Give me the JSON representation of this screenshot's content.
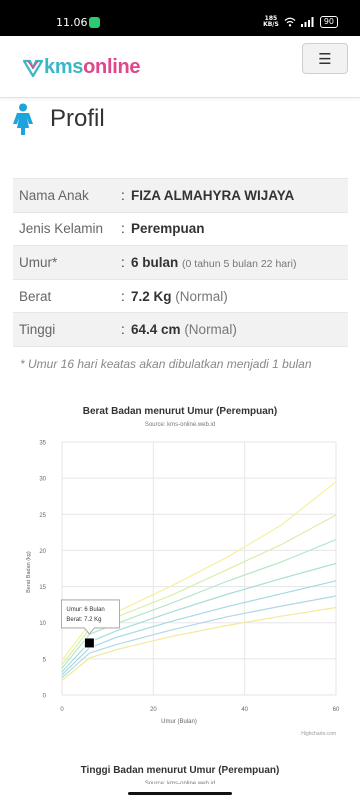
{
  "status_bar": {
    "time": "11.06",
    "net_speed_top": "185",
    "net_speed_bottom": "KB/S",
    "battery": "90"
  },
  "header": {
    "logo_kms": "kms",
    "logo_online": "online",
    "menu_icon": "hamburger-icon"
  },
  "profile": {
    "title": "Profil",
    "icon": "female-child-icon",
    "rows": [
      {
        "label": "Nama Anak",
        "value": "FIZA ALMAHYRA WIJAYA",
        "note": ""
      },
      {
        "label": "Jenis Kelamin",
        "value": "Perempuan",
        "note": ""
      },
      {
        "label": "Umur*",
        "value": "6 bulan",
        "note": "(0 tahun 5 bulan 22 hari)"
      },
      {
        "label": "Berat",
        "value": "7.2 Kg",
        "note": "(Normal)"
      },
      {
        "label": "Tinggi",
        "value": "64.4 cm",
        "note": "(Normal)"
      }
    ],
    "separator": ":",
    "footnote": "* Umur 16 hari keatas akan dibulatkan menjadi 1 bulan"
  },
  "chart_data": [
    {
      "type": "line",
      "title": "Berat Badan menurut Umur (Perempuan)",
      "subtitle": "Source: kms-online.web.id",
      "xlabel": "Umur (Bulan)",
      "ylabel": "Berat Badan (kg)",
      "xlim": [
        0,
        60
      ],
      "ylim": [
        0,
        35
      ],
      "x_ticks": [
        0,
        20,
        40,
        60
      ],
      "y_ticks": [
        0,
        5,
        10,
        15,
        20,
        25,
        30,
        35
      ],
      "grid": true,
      "credits": "Highcharts.com",
      "x": [
        0,
        6,
        12,
        24,
        36,
        48,
        60
      ],
      "series": [
        {
          "color": "#f5f0a0",
          "values": [
            4.8,
            9.8,
            11.5,
            15.1,
            19.0,
            23.5,
            29.5
          ]
        },
        {
          "color": "#d8efa8",
          "values": [
            4.2,
            9.1,
            10.8,
            13.8,
            17.3,
            20.8,
            24.9
          ]
        },
        {
          "color": "#b6e6c8",
          "values": [
            3.7,
            8.4,
            9.9,
            12.7,
            15.7,
            18.4,
            21.5
          ]
        },
        {
          "color": "#a8dcd6",
          "values": [
            3.2,
            7.3,
            8.9,
            11.5,
            13.9,
            16.1,
            18.2
          ]
        },
        {
          "color": "#a6d8e6",
          "values": [
            2.8,
            6.5,
            8.0,
            10.2,
            12.2,
            14.0,
            15.8
          ]
        },
        {
          "color": "#b2d6e8",
          "values": [
            2.4,
            5.8,
            7.0,
            9.0,
            10.8,
            12.3,
            13.7
          ]
        },
        {
          "color": "#f1ea9a",
          "values": [
            2.0,
            5.1,
            6.3,
            8.1,
            9.6,
            10.9,
            12.1
          ]
        }
      ],
      "points": [
        {
          "x": 6,
          "y": 7.2
        }
      ],
      "tooltip": {
        "line1": "Umur: 6 Bulan",
        "line2": "Berat: 7.2 Kg"
      }
    },
    {
      "type": "line",
      "title": "Tinggi Badan menurut Umur (Perempuan)",
      "subtitle": "Source: kms-online.web.id"
    }
  ],
  "nav": {
    "pill": "gesture-bar"
  }
}
